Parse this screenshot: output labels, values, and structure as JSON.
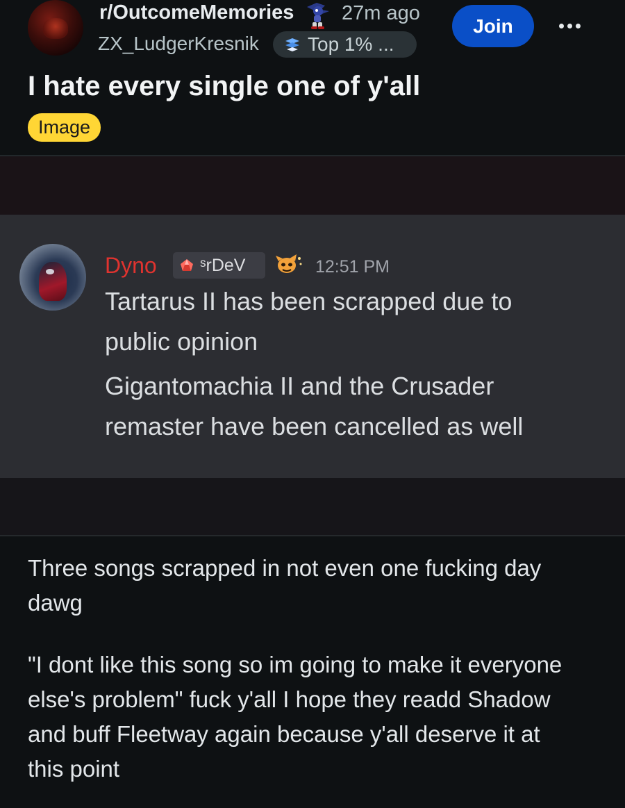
{
  "post": {
    "subreddit": "r/OutcomeMemories",
    "time_ago": "27m ago",
    "username": "ZX_LudgerKresnik",
    "user_flair": "Top 1% ...",
    "join_label": "Join",
    "title": "I hate every single one of y'all",
    "tag": "Image"
  },
  "embed": {
    "author": "Dyno",
    "role_tag": "ˢrDeV",
    "timestamp": "12:51 PM",
    "lines": [
      "Tartarus II has been scrapped due to",
      "public opinion",
      "Gigantomachia II and the Crusader",
      "remaster have been cancelled as well"
    ],
    "colors": {
      "author_name": "#e0332f",
      "role_icon": "#ff6b5f"
    }
  },
  "body": {
    "paragraph_1": [
      "Three songs scrapped in not even one fucking day",
      "dawg"
    ],
    "paragraph_2": [
      "\"I dont like this song so im going to make it everyone",
      "else's problem\" fuck y'all I hope they readd Shadow",
      "and buff Fleetway again because y'all deserve it at",
      "this point"
    ]
  },
  "colors": {
    "background": "#0e1113",
    "join_button": "#0a4fc7",
    "image_tag": "#ffd635",
    "discord_message_bg": "#2c2d32"
  },
  "icons": [
    "subreddit-avatar",
    "flair-figure-icon",
    "flair-badge-icon",
    "more-options-icon",
    "role-gem-icon",
    "emoji-icon"
  ]
}
